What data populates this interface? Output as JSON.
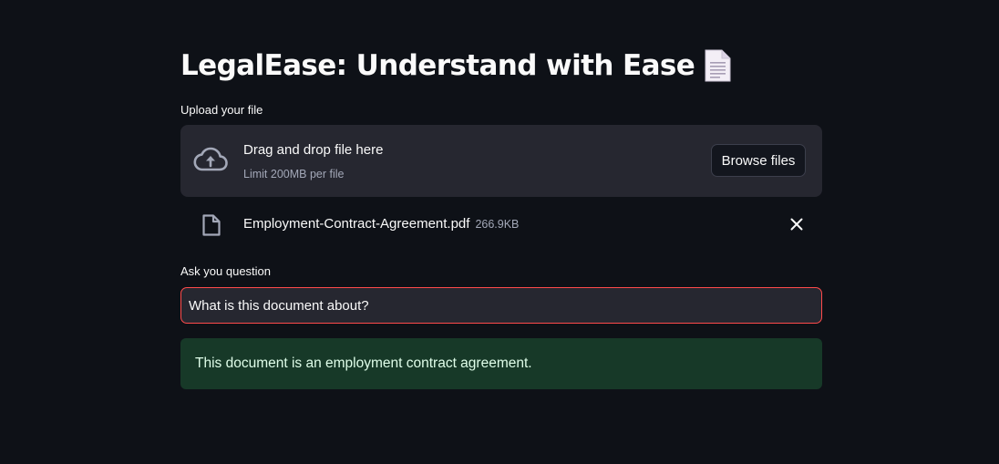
{
  "title": "LegalEase: Understand with Ease",
  "title_icon": "page-facing-up-icon",
  "uploader": {
    "label": "Upload your file",
    "drop_text": "Drag and drop file here",
    "limit_text": "Limit 200MB per file",
    "browse_label": "Browse files",
    "icon": "cloud-upload-icon"
  },
  "uploaded_file": {
    "name": "Employment-Contract-Agreement.pdf",
    "size": "266.9KB",
    "icon": "file-icon"
  },
  "question": {
    "label": "Ask you question",
    "value": "What is this document about?"
  },
  "answer": {
    "text": "This document is an employment contract agreement."
  },
  "colors": {
    "background": "#0e1117",
    "panel": "#262730",
    "accent_border": "#ff4b4b",
    "success_bg": "#173928",
    "success_text": "#dffde9"
  }
}
